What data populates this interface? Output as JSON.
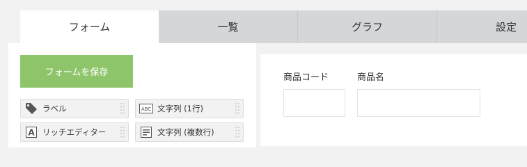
{
  "tabs": [
    {
      "label": "フォーム",
      "active": true
    },
    {
      "label": "一覧",
      "active": false
    },
    {
      "label": "グラフ",
      "active": false
    },
    {
      "label": "設定",
      "active": false
    }
  ],
  "save_button": {
    "label": "フォームを保存",
    "color": "#8ec56b"
  },
  "palette": [
    {
      "label": "ラベル",
      "icon": "tag-icon"
    },
    {
      "label": "文字列 (1行)",
      "icon": "abc-textbox-icon"
    },
    {
      "label": "リッチエディター",
      "icon": "rich-editor-icon"
    },
    {
      "label": "文字列 (複数行)",
      "icon": "multiline-text-icon"
    }
  ],
  "form": {
    "fields": [
      {
        "label": "商品コード",
        "value": ""
      },
      {
        "label": "商品名",
        "value": ""
      }
    ]
  }
}
